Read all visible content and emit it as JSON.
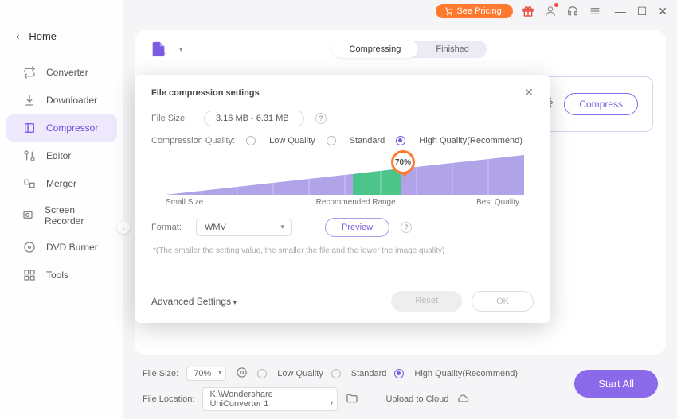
{
  "titlebar": {
    "pricing": "See Pricing"
  },
  "sidebar": {
    "home": "Home",
    "items": [
      {
        "icon": "converter",
        "label": "Converter"
      },
      {
        "icon": "downloader",
        "label": "Downloader"
      },
      {
        "icon": "compressor",
        "label": "Compressor"
      },
      {
        "icon": "editor",
        "label": "Editor"
      },
      {
        "icon": "merger",
        "label": "Merger"
      },
      {
        "icon": "recorder",
        "label": "Screen Recorder"
      },
      {
        "icon": "dvd",
        "label": "DVD Burner"
      },
      {
        "icon": "tools",
        "label": "Tools"
      }
    ]
  },
  "tabs": {
    "compressing": "Compressing",
    "finished": "Finished"
  },
  "filerow": {
    "compress": "Compress"
  },
  "modal": {
    "title": "File compression settings",
    "file_size_label": "File Size:",
    "file_size_value": "3.16 MB - 6.31 MB",
    "quality_label": "Compression Quality:",
    "q_low": "Low Quality",
    "q_std": "Standard",
    "q_high": "High Quality(Recommend)",
    "slider_value": "70%",
    "slider_small": "Small Size",
    "slider_rec": "Recommended Range",
    "slider_best": "Best Quality",
    "format_label": "Format:",
    "format_value": "WMV",
    "preview": "Preview",
    "hint": "*(The smaller the setting value, the smaller the file and the lower the image quality)",
    "advanced": "Advanced Settings",
    "reset": "Reset",
    "ok": "OK"
  },
  "bottom": {
    "file_size_label": "File Size:",
    "file_size_value": "70%",
    "q_low": "Low Quality",
    "q_std": "Standard",
    "q_high": "High Quality(Recommend)",
    "location_label": "File Location:",
    "location_value": "K:\\Wondershare UniConverter 1",
    "upload": "Upload to Cloud",
    "start": "Start All"
  }
}
